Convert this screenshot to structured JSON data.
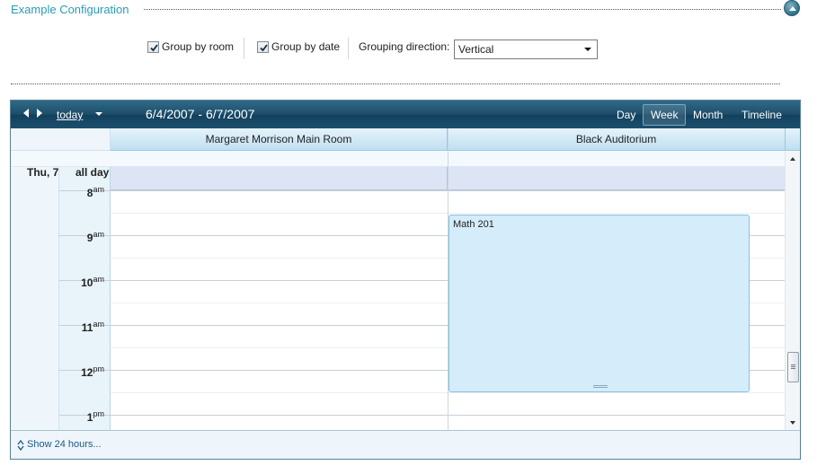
{
  "config": {
    "title": "Example Configuration",
    "group_by_room": {
      "label": "Group by room",
      "checked": true
    },
    "group_by_date": {
      "label": "Group by date",
      "checked": true
    },
    "grouping_direction": {
      "label": "Grouping direction:",
      "value": "Vertical"
    }
  },
  "toolbar": {
    "today": "today",
    "date_range": "6/4/2007 - 6/7/2007",
    "views": [
      "Day",
      "Week",
      "Month",
      "Timeline"
    ],
    "active_view": "Week"
  },
  "resources": [
    "Margaret Morrison Main Room",
    "Black Auditorium"
  ],
  "day_label": "Thu, 7",
  "all_day_label": "all day",
  "hours": [
    {
      "h": "8",
      "ampm": "am"
    },
    {
      "h": "9",
      "ampm": "am"
    },
    {
      "h": "10",
      "ampm": "am"
    },
    {
      "h": "11",
      "ampm": "am"
    },
    {
      "h": "12",
      "ampm": "pm"
    },
    {
      "h": "1",
      "ampm": "pm"
    }
  ],
  "appointment": {
    "title": "Math 201",
    "resource": "Black Auditorium"
  },
  "footer": {
    "show_hours": "Show 24 hours..."
  },
  "colors": {
    "accent": "#2b9bb5",
    "toolbar": "#1d4e6b",
    "appointment": "#d5ecfa"
  }
}
